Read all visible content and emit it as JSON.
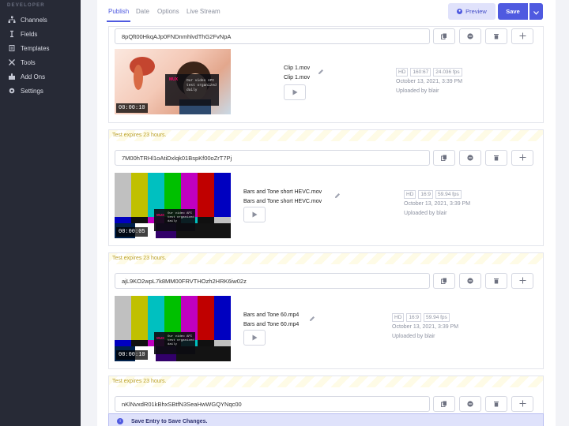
{
  "sidebar": {
    "heading": "DEVELOPER",
    "items": [
      {
        "label": "Channels",
        "icon": "channels-icon"
      },
      {
        "label": "Fields",
        "icon": "fields-icon"
      },
      {
        "label": "Templates",
        "icon": "templates-icon"
      },
      {
        "label": "Tools",
        "icon": "tools-icon"
      },
      {
        "label": "Add Ons",
        "icon": "addons-icon"
      },
      {
        "label": "Settings",
        "icon": "settings-icon"
      }
    ]
  },
  "tabs": [
    "Publish",
    "Date",
    "Options",
    "Live Stream"
  ],
  "toolbar": {
    "preview_label": "Preview",
    "save_label": "Save"
  },
  "colors": {
    "accent": "#4f5ae0",
    "sidebar": "#272a36",
    "expires": "#bba12a"
  },
  "entries": [
    {
      "banner": "",
      "playback_id": "8pQft00HkqAJp0FNDnmhlvdThG2FvNpA",
      "duration": "00:00:10",
      "title": "Clip 1.mov",
      "filename": "Clip 1.mov",
      "chips": [
        "HD",
        "160:67",
        "24.036 fps"
      ],
      "date": "October 13, 2021, 3:39 PM",
      "uploaded": "Uploaded by blair"
    },
    {
      "banner": "Test expires 23 hours.",
      "playback_id": "7M00hTRHl1oAtiDxlqk01BspKf00oZrT7Pj",
      "duration": "00:00:05",
      "title": "Bars and Tone short HEVC.mov",
      "filename": "Bars and Tone short HEVC.mov",
      "chips": [
        "HD",
        "16:9",
        "59.94 fps"
      ],
      "date": "October 13, 2021, 3:39 PM",
      "uploaded": "Uploaded by blair"
    },
    {
      "banner": "Test expires 23 hours.",
      "playback_id": "ajL9KO2wpL7k8MM00FRVTHOzh2HRK6iw02z",
      "duration": "00:00:10",
      "title": "Bars and Tone 60.mp4",
      "filename": "Bars and Tone 60.mp4",
      "chips": [
        "HD",
        "16:9",
        "59.94 fps"
      ],
      "date": "October 13, 2021, 3:39 PM",
      "uploaded": "Uploaded by blair"
    },
    {
      "banner": "Test expires 23 hours.",
      "playback_id": "nKlNvxdR01kBhxSBtfN3SeaHwWGQYNqc00",
      "duration": "",
      "title": "",
      "filename": "",
      "chips": [],
      "date": "",
      "uploaded": ""
    }
  ],
  "thumbnail_overlay": {
    "brand": "MUX",
    "line1": "Our video API",
    "line2": "test organized",
    "line3": "daily"
  },
  "notice": "Save Entry to Save Changes."
}
